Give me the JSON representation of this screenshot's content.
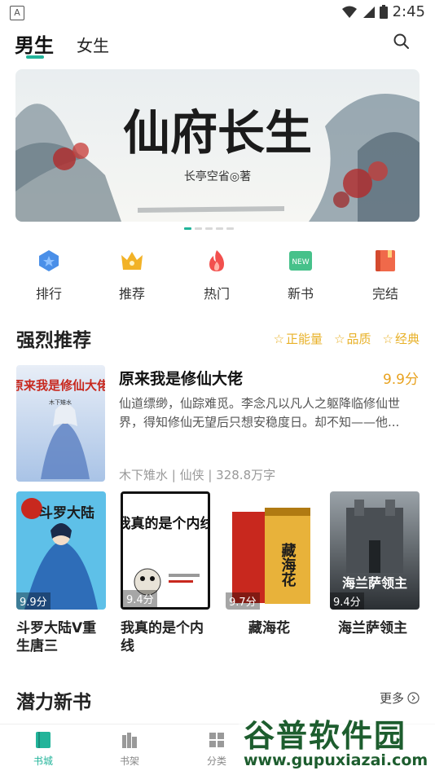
{
  "status_bar": {
    "indicator": "A",
    "time": "2:45"
  },
  "top_nav": {
    "tab_male": "男生",
    "tab_female": "女生",
    "search_icon": "search-icon"
  },
  "banner": {
    "title": "仙府长生",
    "author": "长亭空省◎著"
  },
  "categories": [
    {
      "label": "排行",
      "icon": "ranking-icon",
      "color": "#4a8fe8"
    },
    {
      "label": "推荐",
      "icon": "crown-icon",
      "color": "#f2b227"
    },
    {
      "label": "热门",
      "icon": "flame-icon",
      "color": "#f2504e"
    },
    {
      "label": "新书",
      "icon": "new-badge-icon",
      "badge": "NEW",
      "color": "#46c18a"
    },
    {
      "label": "完结",
      "icon": "book-icon",
      "color": "#f0694a"
    }
  ],
  "recommend": {
    "title": "强烈推荐",
    "tags": [
      "正能量",
      "品质",
      "经典"
    ],
    "featured": {
      "title": "原来我是修仙大佬",
      "score": "9.9分",
      "desc": "仙道缥缈，仙踪难觅。李念凡以凡人之躯降临修仙世界，得知修仙无望后只想安稳度日。却不知——他...",
      "meta": "木下雉水 | 仙侠 | 328.8万字",
      "cover_text": "原来我是修仙大佬",
      "cover_author": "木下雉水"
    },
    "books": [
      {
        "title": "斗罗大陆V重生唐三",
        "score": "9.9分",
        "cover_text": "斗罗大陆"
      },
      {
        "title": "我真的是个内线",
        "score": "9.4分",
        "cover_text": "我真的是个内线"
      },
      {
        "title": "藏海花",
        "score": "9.7分",
        "cover_text": "藏海花"
      },
      {
        "title": "海兰萨领主",
        "score": "9.4分",
        "cover_text": "海兰萨领主"
      }
    ]
  },
  "new_books": {
    "title": "潜力新书",
    "more": "更多"
  },
  "tab_bar": [
    {
      "label": "书城",
      "icon": "bookstore-icon",
      "active": true
    },
    {
      "label": "书架",
      "icon": "bookshelf-icon",
      "active": false
    },
    {
      "label": "分类",
      "icon": "category-icon",
      "active": false
    }
  ],
  "watermark": {
    "name": "谷普软件园",
    "url": "www.gupuxiazai.com"
  },
  "colors": {
    "accent": "#22b49a",
    "score": "#e8a21f",
    "tag": "#e8b128"
  }
}
